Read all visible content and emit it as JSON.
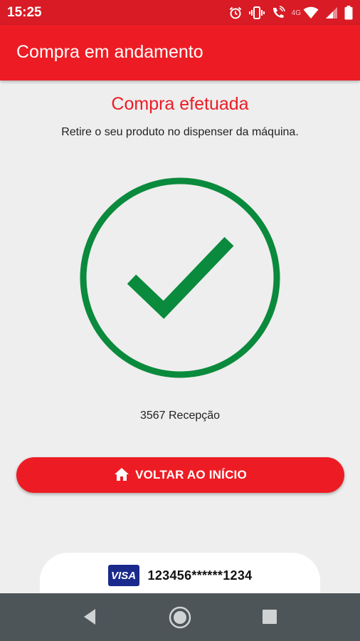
{
  "status_bar": {
    "time": "15:25",
    "network_label": "4G",
    "icons": [
      "alarm-icon",
      "vibrate-icon",
      "wifi-call-icon",
      "wifi-icon",
      "signal-icon",
      "battery-icon"
    ]
  },
  "app_bar": {
    "title": "Compra em andamento"
  },
  "main": {
    "headline": "Compra efetuada",
    "subtitle": "Retire o seu produto no dispenser da máquina.",
    "success_icon": "check-circle-icon",
    "machine_label": "3567 Recepção",
    "home_button": {
      "icon": "home-icon",
      "label": "VOLTAR AO INÍCIO"
    }
  },
  "card": {
    "brand": "VISA",
    "number": "123456******1234"
  },
  "nav_bar": {
    "buttons": [
      "back-icon",
      "home-circle-icon",
      "recents-icon"
    ]
  },
  "colors": {
    "brand_red": "#ed1c24",
    "status_red": "#d81b25",
    "success_green": "#0a8a3c",
    "nav_gray": "#4d5559"
  }
}
